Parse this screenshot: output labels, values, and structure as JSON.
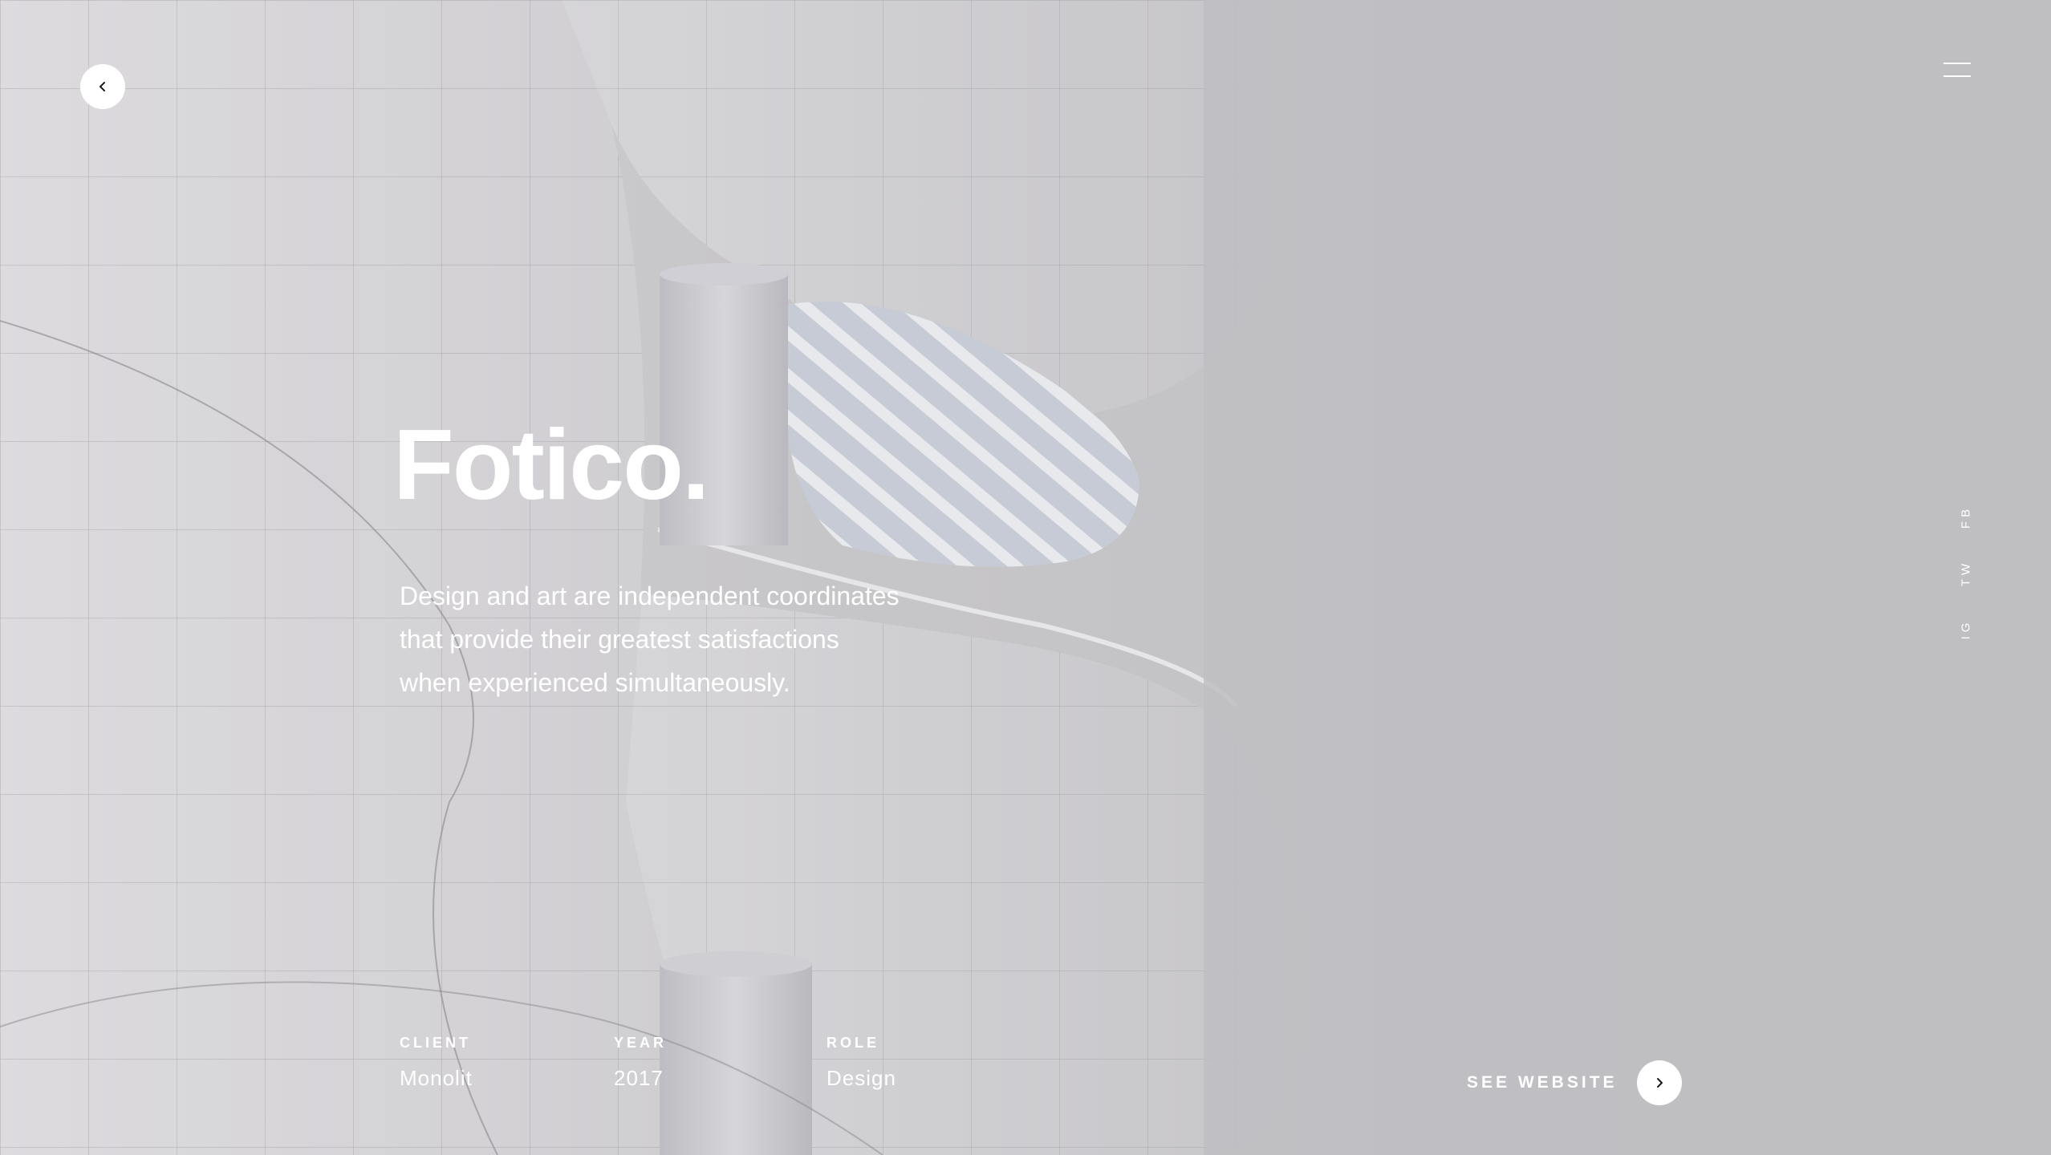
{
  "nav": {
    "back_icon": "chevron-left-icon",
    "menu_icon": "hamburger-menu-icon"
  },
  "hero": {
    "title": "Fotico.",
    "description_lines": [
      "Design and art are independent coordinates",
      "that provide their greatest satisfactions",
      "when experienced simultaneously."
    ]
  },
  "social": {
    "links": [
      "FB",
      "TW",
      "IG"
    ]
  },
  "meta": {
    "client": {
      "label": "CLIENT",
      "value": "Monolit"
    },
    "year": {
      "label": "YEAR",
      "value": "2017"
    },
    "role": {
      "label": "ROLE",
      "value": "Design"
    }
  },
  "cta": {
    "label": "SEE WEBSITE",
    "icon": "chevron-right-icon"
  },
  "colors": {
    "text": "#ffffff",
    "background": "#c1c1c4",
    "icon": "#1a1a1a"
  }
}
